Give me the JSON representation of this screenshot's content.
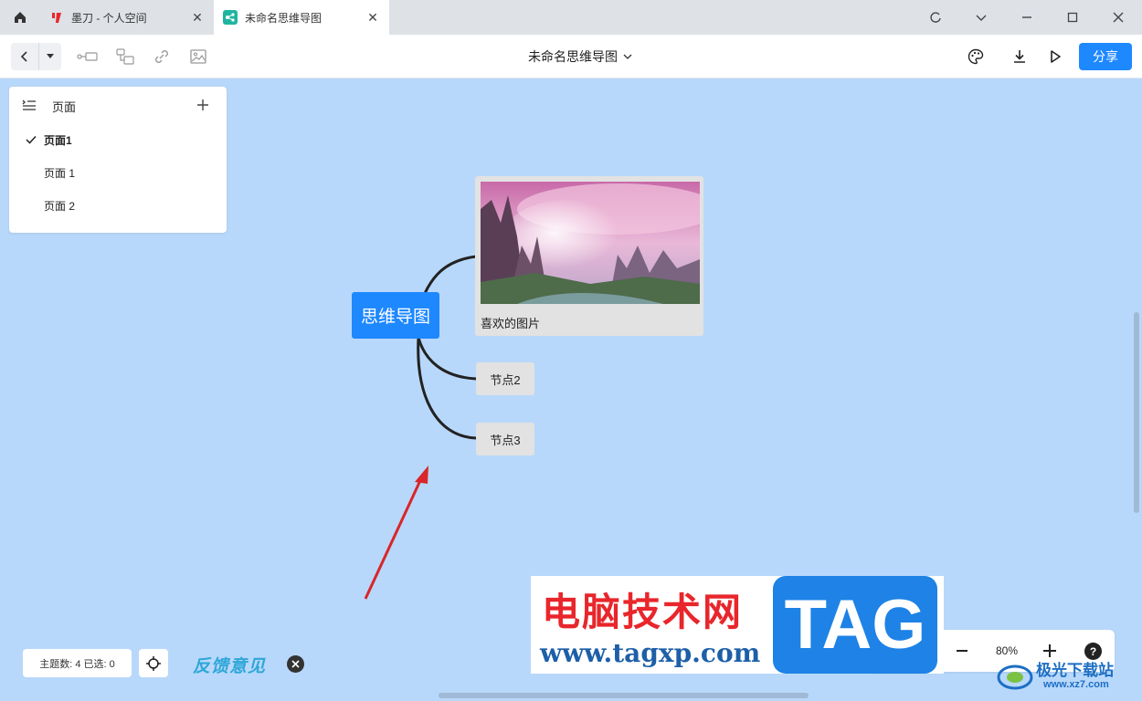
{
  "tabs": [
    {
      "title": "墨刀 - 个人空间",
      "active": false
    },
    {
      "title": "未命名思维导图",
      "active": true
    }
  ],
  "toolbar": {
    "doc_title": "未命名思维导图",
    "share_label": "分享"
  },
  "pages_panel": {
    "title": "页面",
    "items": [
      {
        "label": "页面1",
        "current": true
      },
      {
        "label": "页面 1",
        "current": false
      },
      {
        "label": "页面 2",
        "current": false
      }
    ]
  },
  "mindmap": {
    "root": "思维导图",
    "image_node_caption": "喜欢的图片",
    "nodes": [
      "节点2",
      "节点3"
    ]
  },
  "status": {
    "topic_count_text": "主题数: 4 已选: 0"
  },
  "feedback_label": "反馈意见",
  "zoom": {
    "level": "80%"
  },
  "help_label": "?",
  "watermark": {
    "cn": "电脑技术网",
    "url": "www.tagxp.com",
    "tag": "TAG",
    "site_cn": "极光下载站",
    "site_url": "www.xz7.com"
  },
  "colors": {
    "accent": "#1e88ff",
    "canvas": "#b8d8fb",
    "node_bg": "#e2e2e2"
  }
}
